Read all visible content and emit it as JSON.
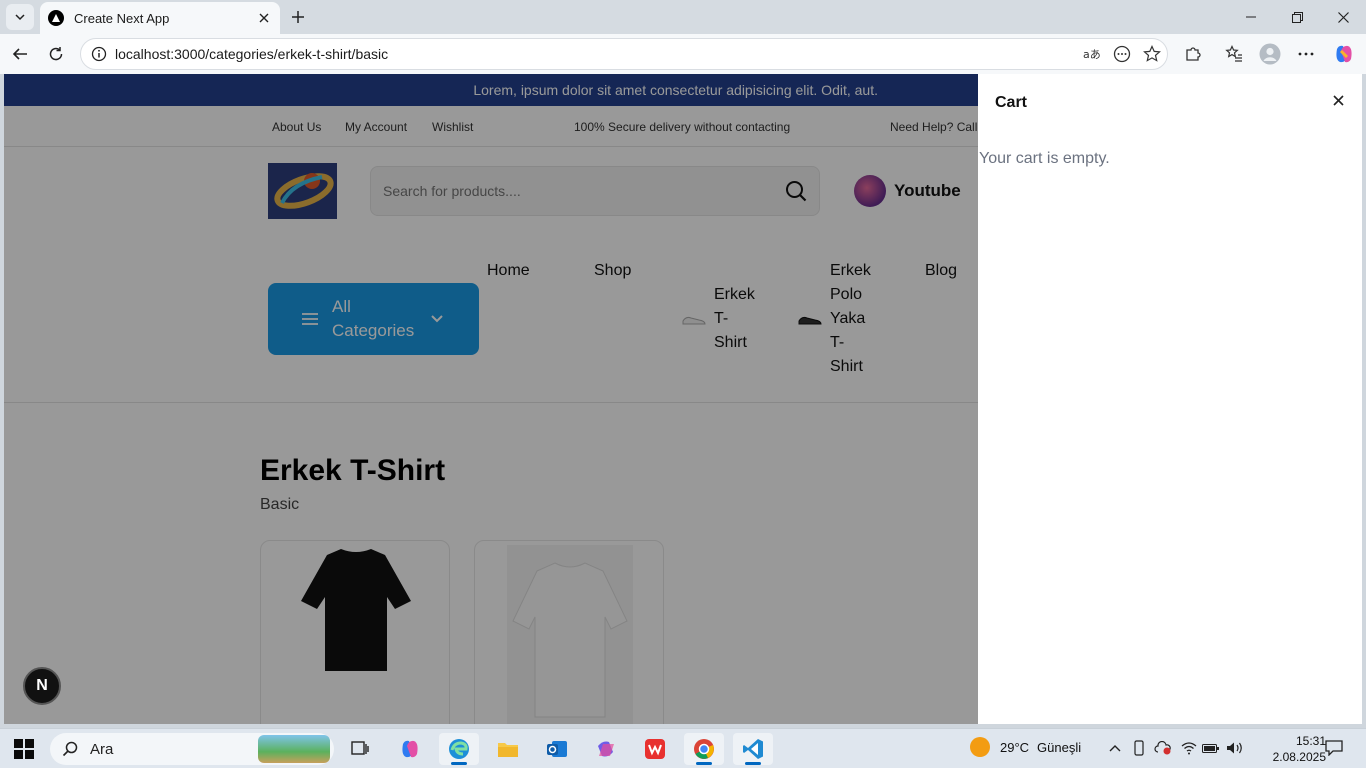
{
  "browser": {
    "tab_title": "Create Next App",
    "url": "localhost:3000/categories/erkek-t-shirt/basic"
  },
  "site": {
    "announcement": "Lorem, ipsum dolor sit amet consectetur adipisicing elit. Odit, aut.",
    "top_links": {
      "about": "About Us",
      "account": "My Account",
      "wishlist": "Wishlist",
      "secure": "100% Secure delivery without contacting",
      "help": "Need Help? Call"
    },
    "search_placeholder": "Search for products....",
    "youtube_label": "Youtube",
    "all_categories": "All Categories",
    "nav": {
      "home": "Home",
      "shop": "Shop",
      "cat1": "Erkek T-Shirt",
      "cat2": "Erkek Polo Yaka T-Shirt",
      "blog": "Blog"
    },
    "page_title": "Erkek T-Shirt",
    "page_subtitle": "Basic",
    "next_badge": "N"
  },
  "cart": {
    "title": "Cart",
    "empty_text": "Your cart is empty."
  },
  "taskbar": {
    "search_text": "Ara",
    "weather_temp": "29°C",
    "weather_text": "Güneşli",
    "time": "15:31",
    "date": "2.08.2025"
  },
  "colors": {
    "announcement_bg": "#23408e",
    "all_categories_bg": "#1a9ae5",
    "overlay": "rgba(0,0,0,0.40)"
  }
}
